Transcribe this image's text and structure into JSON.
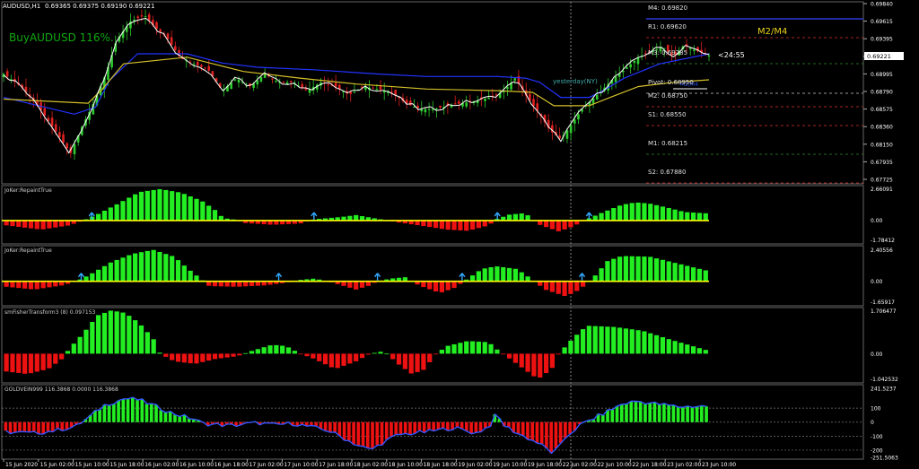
{
  "window": {
    "symbol_title": "AUDUSD,H1",
    "ohlc": "0.69365 0.69375 0.69190 0.69221",
    "signal_text": "BuyAUDUSD 116%."
  },
  "price_axis": {
    "ticks": [
      "0.69840",
      "0.69615",
      "0.69395",
      "0.69175",
      "0.68995",
      "0.68790",
      "0.68575",
      "0.68360",
      "0.68150",
      "0.67935",
      "0.67725"
    ],
    "current_price": "0.69221"
  },
  "pivots": {
    "title": "M2/M4",
    "countdown": "<24:55",
    "yesterday_label": "yesterday(NY)",
    "levels": [
      {
        "label": "M4: 0.69820",
        "color": "#3344ff"
      },
      {
        "label": "R1: 0.69620",
        "color": "#e03030"
      },
      {
        "label": "M3: 0.69285",
        "color": "#2e8b2e"
      },
      {
        "label": "Pivot: 0.68950",
        "color": "#c8c8c8"
      },
      {
        "label": "M2: 0.68750",
        "color": "#e03030"
      },
      {
        "label": "S1: 0.68550",
        "color": "#e03030"
      },
      {
        "label": "M1: 0.68215",
        "color": "#2e8b2e"
      },
      {
        "label": "S2: 0.67880",
        "color": "#e03030"
      }
    ],
    "overlap_label": "M2/M4"
  },
  "panes": [
    {
      "label": "JoKer:RepaintTrue",
      "ticks": [
        "2.66091",
        "0.00",
        "-1.78412"
      ]
    },
    {
      "label": "JoKer:RepaintTrue",
      "ticks": [
        "2.40556",
        "0.00",
        "-1.65917"
      ]
    },
    {
      "label": "smFisherTransform3 (8) 0.097153",
      "ticks": [
        "1.706477",
        "0.00",
        "-1.042532"
      ]
    },
    {
      "label": "GOLDVEIN999 116.3868 0.0000 116.3868",
      "ticks": [
        "241.5237",
        "100",
        "0",
        "-100",
        "-200",
        "-251.5063"
      ]
    }
  ],
  "time_axis": [
    "15 Jun 2020",
    "15 Jun 02:00",
    "15 Jun 10:00",
    "15 Jun 18:00",
    "16 Jun 02:00",
    "16 Jun 10:00",
    "16 Jun 18:00",
    "17 Jun 02:00",
    "17 Jun 10:00",
    "17 Jun 18:00",
    "18 Jun 02:00",
    "18 Jun 10:00",
    "18 Jun 18:00",
    "19 Jun 02:00",
    "19 Jun 10:00",
    "19 Jun 18:00",
    "22 Jun 02:00",
    "22 Jun 10:00",
    "22 Jun 18:00",
    "23 Jun 02:00",
    "23 Jun 10:00"
  ],
  "colors": {
    "background": "#000000",
    "bull_candle": "#2ecc2e",
    "bear_candle": "#e02020",
    "hist_up": "#22ee22",
    "hist_down": "#ee1111",
    "zero_line": "#ffff00",
    "band_blue": "#2233ff",
    "band_yellow": "#d4c02a",
    "price_line": "#ffffff",
    "arrow": "#33aaff",
    "signal_text": "#0fa80f",
    "pivot_title": "#e8d21c",
    "yesterday": "#44aaaa"
  },
  "chart_data": [
    {
      "type": "candlestick",
      "title": "AUDUSD,H1",
      "ylim": [
        0.6772,
        0.6984
      ],
      "x_range": [
        "15 Jun 2020",
        "23 Jun 10:00"
      ],
      "price_path": [
        [
          0,
          0.69
        ],
        [
          0.025,
          0.6885
        ],
        [
          0.05,
          0.686
        ],
        [
          0.075,
          0.683
        ],
        [
          0.095,
          0.6805
        ],
        [
          0.11,
          0.6835
        ],
        [
          0.125,
          0.686
        ],
        [
          0.145,
          0.69
        ],
        [
          0.16,
          0.694
        ],
        [
          0.18,
          0.6963
        ],
        [
          0.2,
          0.697
        ],
        [
          0.215,
          0.6955
        ],
        [
          0.23,
          0.6945
        ],
        [
          0.25,
          0.692
        ],
        [
          0.27,
          0.6912
        ],
        [
          0.29,
          0.6905
        ],
        [
          0.31,
          0.688
        ],
        [
          0.33,
          0.6895
        ],
        [
          0.35,
          0.6885
        ],
        [
          0.37,
          0.69
        ],
        [
          0.39,
          0.689
        ],
        [
          0.41,
          0.689
        ],
        [
          0.43,
          0.688
        ],
        [
          0.45,
          0.689
        ],
        [
          0.47,
          0.6885
        ],
        [
          0.49,
          0.6875
        ],
        [
          0.51,
          0.6885
        ],
        [
          0.53,
          0.6882
        ],
        [
          0.55,
          0.6878
        ],
        [
          0.57,
          0.6865
        ],
        [
          0.59,
          0.6858
        ],
        [
          0.61,
          0.6858
        ],
        [
          0.63,
          0.6862
        ],
        [
          0.65,
          0.6865
        ],
        [
          0.67,
          0.6868
        ],
        [
          0.69,
          0.6872
        ],
        [
          0.71,
          0.688
        ],
        [
          0.725,
          0.6895
        ],
        [
          0.74,
          0.6875
        ],
        [
          0.76,
          0.6852
        ],
        [
          0.775,
          0.6832
        ],
        [
          0.79,
          0.6822
        ],
        [
          0.805,
          0.684
        ],
        [
          0.82,
          0.6858
        ],
        [
          0.835,
          0.687
        ],
        [
          0.85,
          0.6882
        ],
        [
          0.865,
          0.6895
        ],
        [
          0.88,
          0.6905
        ],
        [
          0.9,
          0.692
        ],
        [
          0.92,
          0.6928
        ],
        [
          0.935,
          0.6932
        ],
        [
          0.95,
          0.692
        ],
        [
          0.965,
          0.6935
        ],
        [
          0.975,
          0.693
        ],
        [
          1.0,
          0.6922
        ]
      ],
      "band_blue": [
        [
          0,
          0.6872
        ],
        [
          0.1,
          0.6852
        ],
        [
          0.13,
          0.686
        ],
        [
          0.15,
          0.6892
        ],
        [
          0.19,
          0.6924
        ],
        [
          0.26,
          0.6924
        ],
        [
          0.31,
          0.6913
        ],
        [
          0.36,
          0.6908
        ],
        [
          0.44,
          0.6905
        ],
        [
          0.53,
          0.69
        ],
        [
          0.6,
          0.6897
        ],
        [
          0.7,
          0.6897
        ],
        [
          0.74,
          0.6895
        ],
        [
          0.76,
          0.689
        ],
        [
          0.79,
          0.6872
        ],
        [
          0.83,
          0.6872
        ],
        [
          0.85,
          0.688
        ],
        [
          0.88,
          0.6895
        ],
        [
          0.93,
          0.6912
        ],
        [
          1.0,
          0.6924
        ]
      ],
      "band_yellow": [
        [
          0,
          0.687
        ],
        [
          0.12,
          0.6865
        ],
        [
          0.14,
          0.6882
        ],
        [
          0.17,
          0.6912
        ],
        [
          0.26,
          0.692
        ],
        [
          0.34,
          0.6903
        ],
        [
          0.42,
          0.6895
        ],
        [
          0.5,
          0.6888
        ],
        [
          0.6,
          0.6882
        ],
        [
          0.7,
          0.688
        ],
        [
          0.75,
          0.6878
        ],
        [
          0.78,
          0.6862
        ],
        [
          0.8,
          0.6862
        ],
        [
          0.83,
          0.6862
        ],
        [
          0.86,
          0.6872
        ],
        [
          0.9,
          0.6885
        ],
        [
          0.95,
          0.689
        ],
        [
          1.0,
          0.6893
        ]
      ]
    },
    {
      "type": "bar",
      "title": "JoKer:RepaintTrue",
      "ylim": [
        -1.78412,
        2.66091
      ],
      "profile": [
        [
          0,
          -0.4
        ],
        [
          0.05,
          -0.75
        ],
        [
          0.09,
          -0.4
        ],
        [
          0.11,
          0.0
        ],
        [
          0.13,
          0.5
        ],
        [
          0.16,
          1.4
        ],
        [
          0.19,
          2.35
        ],
        [
          0.22,
          2.6
        ],
        [
          0.25,
          2.3
        ],
        [
          0.28,
          1.6
        ],
        [
          0.3,
          0.8
        ],
        [
          0.31,
          0.2
        ],
        [
          0.33,
          0.05
        ],
        [
          0.34,
          -0.2
        ],
        [
          0.38,
          -0.35
        ],
        [
          0.42,
          -0.25
        ],
        [
          0.44,
          0.1
        ],
        [
          0.48,
          0.3
        ],
        [
          0.5,
          0.45
        ],
        [
          0.52,
          0.25
        ],
        [
          0.54,
          0.05
        ],
        [
          0.56,
          -0.15
        ],
        [
          0.59,
          -0.4
        ],
        [
          0.63,
          -0.75
        ],
        [
          0.66,
          -0.85
        ],
        [
          0.69,
          -0.4
        ],
        [
          0.7,
          0.1
        ],
        [
          0.72,
          0.5
        ],
        [
          0.74,
          0.6
        ],
        [
          0.75,
          0.3
        ],
        [
          0.76,
          -0.3
        ],
        [
          0.79,
          -0.9
        ],
        [
          0.81,
          -0.5
        ],
        [
          0.83,
          0.1
        ],
        [
          0.85,
          0.6
        ],
        [
          0.88,
          1.3
        ],
        [
          0.9,
          1.5
        ],
        [
          0.92,
          1.4
        ],
        [
          0.95,
          1.0
        ],
        [
          0.97,
          0.7
        ],
        [
          1.0,
          0.6
        ]
      ],
      "arrows": [
        0.125,
        0.44,
        0.7,
        0.83
      ]
    },
    {
      "type": "bar",
      "title": "JoKer:RepaintTrue",
      "ylim": [
        -1.65917,
        2.40556
      ],
      "profile": [
        [
          0,
          -0.4
        ],
        [
          0.04,
          -0.6
        ],
        [
          0.08,
          -0.3
        ],
        [
          0.1,
          0.0
        ],
        [
          0.12,
          0.5
        ],
        [
          0.15,
          1.4
        ],
        [
          0.18,
          2.0
        ],
        [
          0.21,
          2.3
        ],
        [
          0.24,
          1.8
        ],
        [
          0.26,
          0.9
        ],
        [
          0.28,
          0.1
        ],
        [
          0.29,
          -0.35
        ],
        [
          0.33,
          -0.4
        ],
        [
          0.37,
          -0.3
        ],
        [
          0.4,
          -0.1
        ],
        [
          0.42,
          0.1
        ],
        [
          0.44,
          0.2
        ],
        [
          0.46,
          0.0
        ],
        [
          0.48,
          -0.3
        ],
        [
          0.5,
          -0.6
        ],
        [
          0.52,
          -0.3
        ],
        [
          0.53,
          0.0
        ],
        [
          0.55,
          0.2
        ],
        [
          0.57,
          0.3
        ],
        [
          0.59,
          -0.3
        ],
        [
          0.62,
          -0.85
        ],
        [
          0.64,
          -0.5
        ],
        [
          0.66,
          0.2
        ],
        [
          0.68,
          0.9
        ],
        [
          0.7,
          1.1
        ],
        [
          0.73,
          0.9
        ],
        [
          0.75,
          0.2
        ],
        [
          0.77,
          -0.6
        ],
        [
          0.8,
          -1.1
        ],
        [
          0.82,
          -0.6
        ],
        [
          0.84,
          0.3
        ],
        [
          0.86,
          1.5
        ],
        [
          0.88,
          1.85
        ],
        [
          0.92,
          1.8
        ],
        [
          0.96,
          1.3
        ],
        [
          1.0,
          0.8
        ]
      ],
      "arrows": [
        0.11,
        0.39,
        0.53,
        0.65,
        0.82
      ]
    },
    {
      "type": "bar",
      "title": "smFisherTransform3 (8) 0.097153",
      "ylim": [
        -1.042532,
        1.706477
      ],
      "profile": [
        [
          0,
          -0.7
        ],
        [
          0.03,
          -0.8
        ],
        [
          0.06,
          -0.6
        ],
        [
          0.08,
          -0.2
        ],
        [
          0.09,
          0.2
        ],
        [
          0.11,
          0.8
        ],
        [
          0.13,
          1.5
        ],
        [
          0.15,
          1.7
        ],
        [
          0.17,
          1.6
        ],
        [
          0.19,
          1.2
        ],
        [
          0.21,
          0.6
        ],
        [
          0.22,
          0.0
        ],
        [
          0.24,
          -0.3
        ],
        [
          0.27,
          -0.4
        ],
        [
          0.3,
          -0.2
        ],
        [
          0.33,
          -0.1
        ],
        [
          0.35,
          0.1
        ],
        [
          0.38,
          0.35
        ],
        [
          0.4,
          0.3
        ],
        [
          0.42,
          0.0
        ],
        [
          0.44,
          -0.2
        ],
        [
          0.47,
          -0.6
        ],
        [
          0.5,
          -0.3
        ],
        [
          0.52,
          0.0
        ],
        [
          0.54,
          0.1
        ],
        [
          0.56,
          -0.4
        ],
        [
          0.58,
          -0.8
        ],
        [
          0.6,
          -0.6
        ],
        [
          0.61,
          -0.1
        ],
        [
          0.63,
          0.3
        ],
        [
          0.66,
          0.5
        ],
        [
          0.69,
          0.45
        ],
        [
          0.7,
          0.2
        ],
        [
          0.72,
          -0.2
        ],
        [
          0.74,
          -0.6
        ],
        [
          0.76,
          -1.0
        ],
        [
          0.78,
          -0.6
        ],
        [
          0.79,
          0.0
        ],
        [
          0.81,
          0.6
        ],
        [
          0.83,
          1.1
        ],
        [
          0.87,
          1.05
        ],
        [
          0.91,
          0.9
        ],
        [
          0.95,
          0.55
        ],
        [
          1.0,
          0.15
        ]
      ]
    },
    {
      "type": "bar",
      "title": "GOLDVEIN999 116.3868 0.0000 116.3868",
      "ylim": [
        -251.5063,
        241.5237
      ],
      "profile": [
        [
          0,
          -70
        ],
        [
          0.04,
          -80
        ],
        [
          0.07,
          -60
        ],
        [
          0.1,
          -30
        ],
        [
          0.12,
          40
        ],
        [
          0.14,
          120
        ],
        [
          0.17,
          170
        ],
        [
          0.19,
          160
        ],
        [
          0.21,
          120
        ],
        [
          0.24,
          60
        ],
        [
          0.27,
          20
        ],
        [
          0.28,
          -10
        ],
        [
          0.32,
          -25
        ],
        [
          0.36,
          -5
        ],
        [
          0.38,
          -20
        ],
        [
          0.41,
          -10
        ],
        [
          0.43,
          -30
        ],
        [
          0.46,
          -60
        ],
        [
          0.48,
          -110
        ],
        [
          0.5,
          -160
        ],
        [
          0.52,
          -200
        ],
        [
          0.54,
          -140
        ],
        [
          0.56,
          -90
        ],
        [
          0.6,
          -70
        ],
        [
          0.64,
          -40
        ],
        [
          0.67,
          -80
        ],
        [
          0.69,
          -30
        ],
        [
          0.7,
          60
        ],
        [
          0.71,
          -20
        ],
        [
          0.73,
          -80
        ],
        [
          0.76,
          -150
        ],
        [
          0.78,
          -220
        ],
        [
          0.79,
          -180
        ],
        [
          0.8,
          -100
        ],
        [
          0.82,
          -20
        ],
        [
          0.84,
          30
        ],
        [
          0.86,
          80
        ],
        [
          0.88,
          130
        ],
        [
          0.9,
          150
        ],
        [
          0.93,
          130
        ],
        [
          0.96,
          110
        ],
        [
          1.0,
          115
        ]
      ]
    }
  ]
}
